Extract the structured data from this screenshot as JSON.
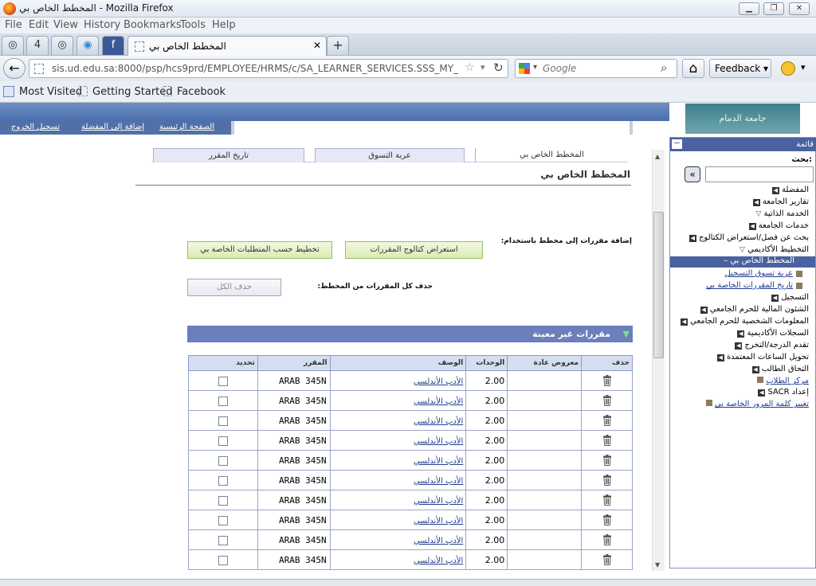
{
  "window": {
    "title": "المخطط الخاص بي - Mozilla Firefox",
    "min": "▁",
    "max": "❐",
    "close": "✕"
  },
  "menu": [
    "File",
    "Edit",
    "View",
    "History",
    "Bookmarks",
    "Tools",
    "Help"
  ],
  "tabs": {
    "small": [
      "◎",
      "4",
      "◎",
      "◉",
      "f"
    ],
    "active": "المخطط الخاص بي",
    "close": "✕",
    "new": "+"
  },
  "nav": {
    "back": "←",
    "url": "sis.ud.edu.sa:8000/psp/hcs9prd/EMPLOYEE/HRMS/c/SA_LEARNER_SERVICES.SSS_MY_PLANNER.GBL",
    "search_placeholder": "Google",
    "home": "⌂",
    "feedback": "Feedback"
  },
  "bookmarks": [
    "Most Visited",
    "Getting Started",
    "Facebook"
  ],
  "topnav": [
    "الصفحة الرئيسية",
    "إضافة إلى المفضلة",
    "تسجيل الخروج"
  ],
  "logo": "جامعة الدمام",
  "ptabs": [
    "المخطط الخاص بي",
    "عربة التسوق",
    "تاريخ المقرر"
  ],
  "page_title": "المخطط الخاص بي",
  "add_label": "إضافة مقررات إلى مخطط باستخدام:",
  "btn_catalog": "استعراض كتالوج المقررات",
  "btn_requirements": "تخطيط حسب المتطلبات الخاصة بي",
  "delete_all_label": "حذف كل المقررات من المخطط:",
  "btn_delete_all": "حذف الكل",
  "section_title": "مقررات غير معينة",
  "table": {
    "headers": [
      "تحديد",
      "المقرر",
      "الوصف",
      "الوحدات",
      "معروض عادة",
      "حذف"
    ],
    "rows": [
      {
        "course": "ARAB 345N",
        "desc": "الأدب الأندلسي",
        "units": "2.00"
      },
      {
        "course": "ARAB 345N",
        "desc": "الأدب الأندلسي",
        "units": "2.00"
      },
      {
        "course": "ARAB 345N",
        "desc": "الأدب الأندلسي",
        "units": "2.00"
      },
      {
        "course": "ARAB 345N",
        "desc": "الأدب الأندلسي",
        "units": "2.00"
      },
      {
        "course": "ARAB 345N",
        "desc": "الأدب الأندلسي",
        "units": "2.00"
      },
      {
        "course": "ARAB 345N",
        "desc": "الأدب الأندلسي",
        "units": "2.00"
      },
      {
        "course": "ARAB 345N",
        "desc": "الأدب الأندلسي",
        "units": "2.00"
      },
      {
        "course": "ARAB 345N",
        "desc": "الأدب الأندلسي",
        "units": "2.00"
      },
      {
        "course": "ARAB 345N",
        "desc": "الأدب الأندلسي",
        "units": "2.00"
      },
      {
        "course": "ARAB 345N",
        "desc": "الأدب الأندلسي",
        "units": "2.00"
      }
    ]
  },
  "panel": {
    "title": "قائمة",
    "search_label": "بحث:",
    "items": [
      "المفضلة",
      "تقارير الجامعة",
      "الخدمة الذاتية",
      "خدمات الجامعة",
      "بحث عن فصل/استعراض الكتالوج",
      "التخطيط الأكاديمي",
      "المخطط الخاص بي",
      "عربة تسوق التسجيل",
      "تاريخ المقررات الخاصة بي",
      "التسجيل",
      "الشئون المالية للحرم الجامعي",
      "المعلومات الشخصية للحرم الجامعي",
      "السجلات الأكاديمية",
      "تقدم الدرجة/التخرج",
      "تحويل الساعات المعتمدة",
      "التحاق الطالب",
      "مركز الطلاب",
      "إعداد SACR",
      "تغيير كلمة المرور الخاصة بي"
    ]
  }
}
